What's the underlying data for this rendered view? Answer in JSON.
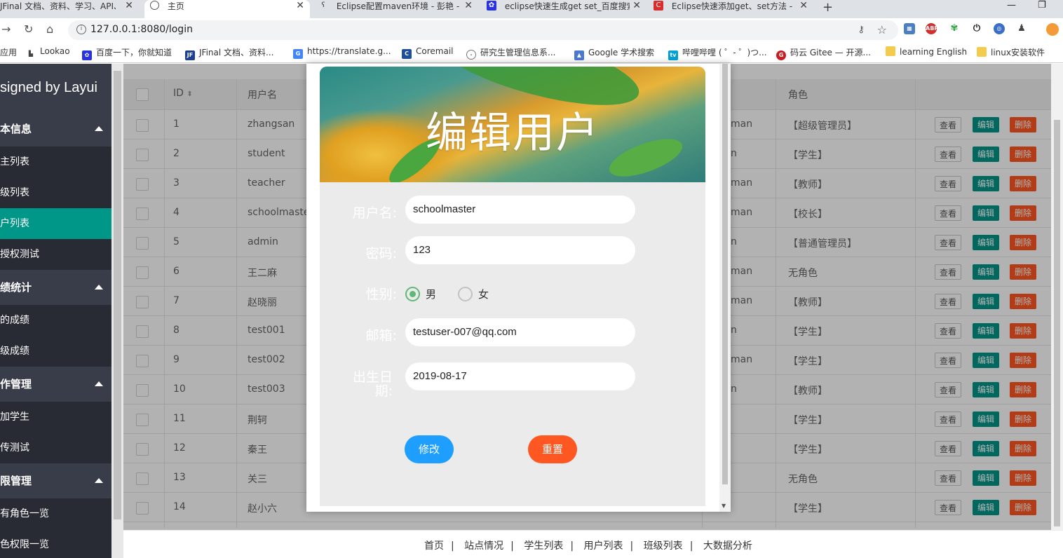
{
  "browser": {
    "tabs": [
      {
        "title": "JFinal 文档、资料、学习、API、",
        "active": false
      },
      {
        "title": "主页",
        "active": true
      },
      {
        "title": "Eclipse配置maven环境 - 彭艳 -",
        "active": false
      },
      {
        "title": "eclipse快速生成get set_百度搜索",
        "active": false
      },
      {
        "title": "Eclipse快速添加get、set方法 - ",
        "active": false
      }
    ],
    "close_glyph": "✕",
    "new_tab_glyph": "+",
    "url": "127.0.0.1:8080/login",
    "bookmarks": [
      "应用",
      "Lookao",
      "百度一下，你就知道",
      "JFinal 文档、资料...",
      "https://translate.g...",
      "Coremail",
      "研究生管理信息系...",
      "Google 学术搜索",
      "哔哩哔哩 ( ゜- ゜)つ...",
      "码云 Gitee — 开源...",
      "learning English",
      "linux安装软件"
    ]
  },
  "sidebar": {
    "logo": "signed by Layui",
    "groups": [
      {
        "label": "本信息",
        "items": [
          "主列表",
          "级列表",
          "户列表",
          "授权测试"
        ],
        "selected": 2
      },
      {
        "label": "绩统计",
        "items": [
          "的成绩",
          "级成绩"
        ],
        "selected": -1
      },
      {
        "label": "作管理",
        "items": [
          "加学生",
          "传测试"
        ],
        "selected": -1
      },
      {
        "label": "限管理",
        "items": [
          "有角色一览",
          "色权限一览"
        ],
        "selected": -1
      }
    ]
  },
  "table": {
    "headers": {
      "id": "ID",
      "username": "用户名",
      "role": "角色"
    },
    "actions": {
      "view": "查看",
      "edit": "编辑",
      "delete": "删除"
    },
    "rows": [
      {
        "id": "1",
        "username": "zhangsan",
        "gender": "man",
        "role": "【超级管理员】"
      },
      {
        "id": "2",
        "username": "student",
        "gender": "n",
        "role": "【学生】"
      },
      {
        "id": "3",
        "username": "teacher",
        "gender": "man",
        "role": "【教师】"
      },
      {
        "id": "4",
        "username": "schoolmaste",
        "gender": "man",
        "role": "【校长】"
      },
      {
        "id": "5",
        "username": "admin",
        "gender": "n",
        "role": "【普通管理员】"
      },
      {
        "id": "6",
        "username": "王二麻",
        "gender": "man",
        "role": "无角色"
      },
      {
        "id": "7",
        "username": "赵晓丽",
        "gender": "man",
        "role": "【教师】"
      },
      {
        "id": "8",
        "username": "test001",
        "gender": "n",
        "role": "【学生】"
      },
      {
        "id": "9",
        "username": "test002",
        "gender": "man",
        "role": "【学生】"
      },
      {
        "id": "10",
        "username": "test003",
        "gender": "n",
        "role": "【教师】"
      },
      {
        "id": "11",
        "username": "荆轲",
        "gender": "",
        "role": "【学生】"
      },
      {
        "id": "12",
        "username": "秦王",
        "gender": "",
        "role": "【学生】"
      },
      {
        "id": "13",
        "username": "关三",
        "gender": "",
        "role": "无角色"
      },
      {
        "id": "14",
        "username": "赵小六",
        "gender": "",
        "role": "【学生】"
      }
    ]
  },
  "footer": {
    "links": [
      "首页",
      "站点情况",
      "学生列表",
      "用户列表",
      "班级列表",
      "大数据分析"
    ],
    "separator": "|"
  },
  "modal": {
    "title": "编辑用户",
    "fields": {
      "username_label": "用户名:",
      "username_value": "schoolmaster",
      "password_label": "密码:",
      "password_value": "123",
      "gender_label": "性别:",
      "gender_male": "男",
      "gender_female": "女",
      "email_label": "邮箱:",
      "email_value": "testuser-007@qq.com",
      "birth_label_1": "出生日",
      "birth_label_2": "期:",
      "birth_value": "2019-08-17"
    },
    "submit": "修改",
    "reset": "重置"
  },
  "colors": {
    "sidebar_bg": "#393d49",
    "sidebar_selected": "#009688",
    "edit_btn": "#009688",
    "delete_btn": "#ff5722",
    "submit_btn": "#1e9fff",
    "reset_btn": "#ff5722"
  }
}
